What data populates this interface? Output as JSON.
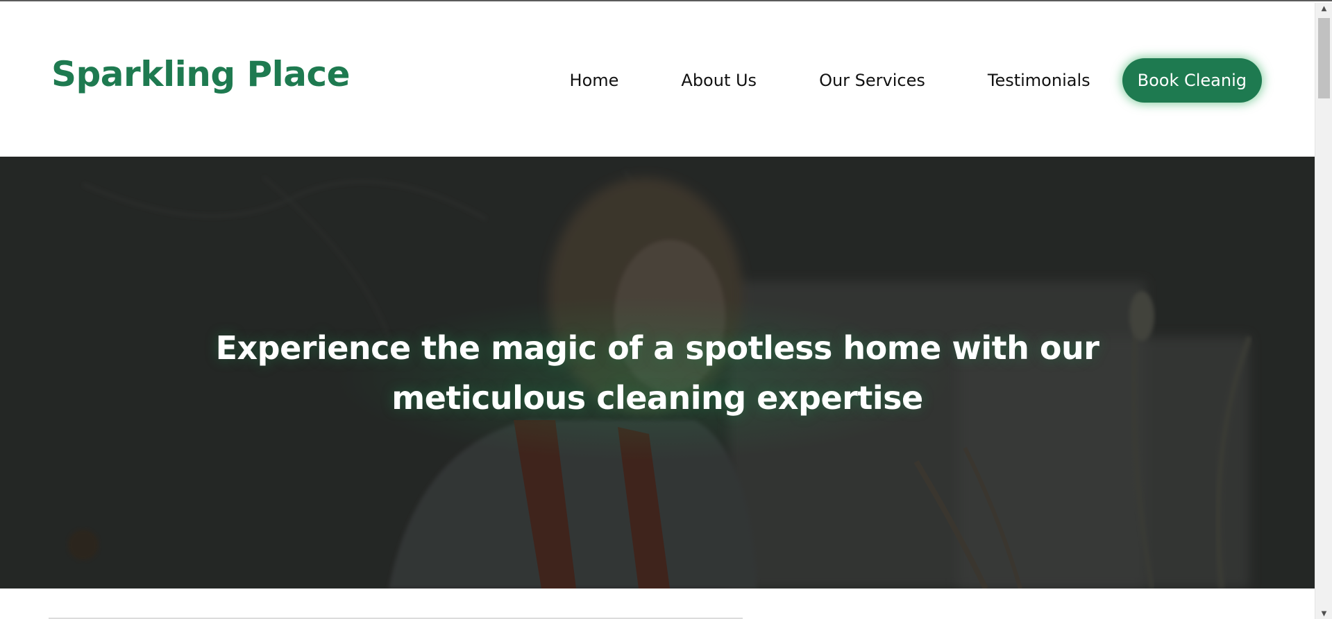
{
  "brand": {
    "name": "Sparkling Place",
    "accent_color": "#1e7a50"
  },
  "nav": {
    "items": [
      {
        "label": "Home"
      },
      {
        "label": "About Us"
      },
      {
        "label": "Our Services"
      },
      {
        "label": "Testimonials"
      }
    ],
    "cta_label": "Book Cleanig"
  },
  "hero": {
    "heading": "Experience the magic of a spotless home with our meticulous cleaning expertise",
    "background_image": "woman-cleaning-photo"
  },
  "scrollbar": {
    "up_icon": "arrow-up-icon",
    "down_icon": "arrow-down-icon"
  }
}
